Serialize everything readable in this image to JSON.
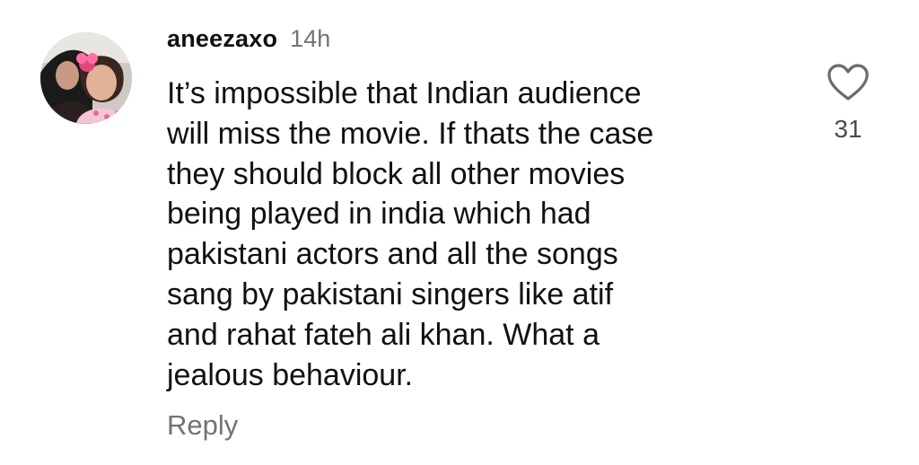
{
  "comment": {
    "avatar_icon": "profile-photo",
    "username": "aneezaxo",
    "timestamp": "14h",
    "lines": [
      "It’s impossible that Indian audience",
      "will miss the movie. If thats the case",
      "they should block all other movies",
      "being played in india which had",
      "pakistani  actors and all the songs",
      "sang by pakistani singers like atif",
      "and rahat fateh ali khan. What a",
      "jealous behaviour."
    ],
    "reply_label": "Reply",
    "like_icon": "heart-outline-icon",
    "like_count": "31"
  },
  "colors": {
    "text_primary": "#111111",
    "text_secondary": "#737373",
    "background": "#ffffff"
  }
}
